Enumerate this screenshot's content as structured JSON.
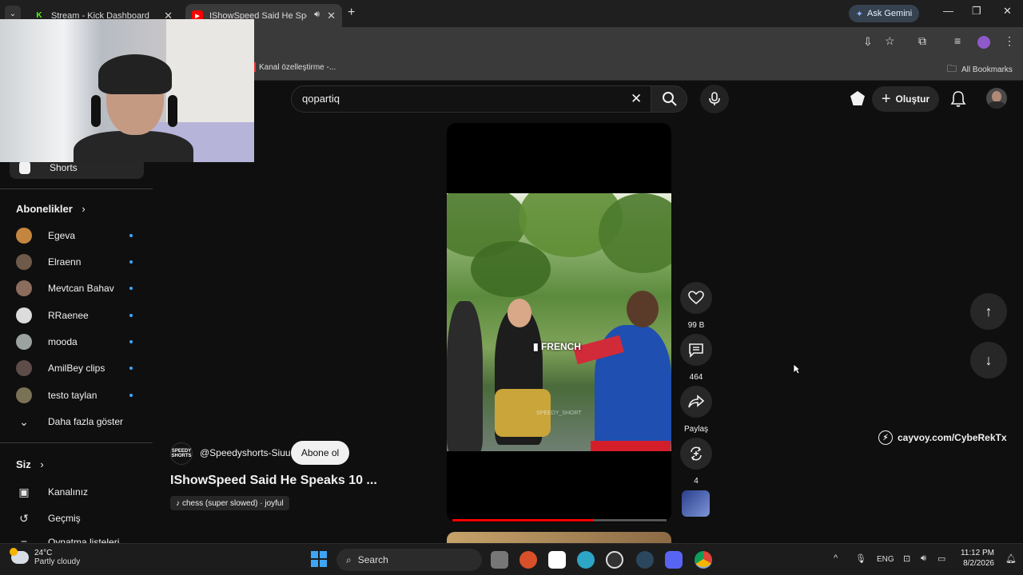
{
  "browser": {
    "tabs": [
      {
        "title": "Stream - Kick Dashboard",
        "favicon": "K",
        "color": "#53fc18"
      },
      {
        "title": "IShowSpeed Said He Speak",
        "favicon": "▶",
        "color": "#ff0000"
      }
    ],
    "new_tab": "+",
    "gemini": "Ask Gemini",
    "bookmark_item": "Kanal özelleştirme -...",
    "all_bookmarks": "All Bookmarks"
  },
  "youtube": {
    "search_value": "qopartiq",
    "create_label": "Oluştur"
  },
  "sidebar": {
    "shorts": "Shorts",
    "subs_heading": "Abonelikler",
    "subscriptions": [
      {
        "name": "Egeva",
        "color": "#c4863e"
      },
      {
        "name": "Elraenn",
        "color": "#6e5a4a"
      },
      {
        "name": "Mevtcan Bahav",
        "color": "#8c6d5d"
      },
      {
        "name": "RRaenee",
        "color": "#dcdcdc"
      },
      {
        "name": "mooda",
        "color": "#9aa3a0"
      },
      {
        "name": "AmilBey clips",
        "color": "#5d4c49"
      },
      {
        "name": "testo taylan",
        "color": "#7a7255"
      }
    ],
    "show_more": "Daha fazla göster",
    "you_heading": "Siz",
    "your_channel": "Kanalınız",
    "history": "Geçmiş",
    "playlists_partial": "Oynatma listeleri"
  },
  "short": {
    "overlay_text": "FRENCH",
    "watermark": "SPEEDY_SHORT",
    "progress": 0.66,
    "channel_logo_text": "SPEEDY SHORTS",
    "channel": "@Speedyshorts-Siuu",
    "subscribe": "Abone ol",
    "title": "IShowSpeed Said He Speaks 10 ...",
    "music": "chess (super slowed) · joyful",
    "actions": {
      "likes": "99 B",
      "comments": "464",
      "share": "Paylaş",
      "remix": "4"
    }
  },
  "promo": "cayvoy.com/CybeRekTx",
  "taskbar": {
    "weather_temp": "24°C",
    "weather_desc": "Partly cloudy",
    "search": "Search",
    "lang": "ENG",
    "time": "11:12 PM",
    "date": "8/2/2026"
  }
}
